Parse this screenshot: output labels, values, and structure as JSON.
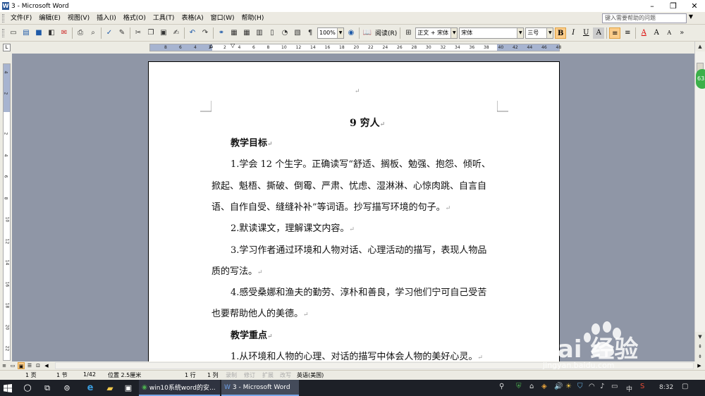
{
  "window": {
    "title": "3 - Microsoft Word",
    "minimize": "–",
    "maximize": "❐",
    "close": "✕"
  },
  "menu": [
    "文件(F)",
    "编辑(E)",
    "视图(V)",
    "插入(I)",
    "格式(O)",
    "工具(T)",
    "表格(A)",
    "窗口(W)",
    "帮助(H)"
  ],
  "help": {
    "placeholder": "键入需要帮助的问题"
  },
  "toolbar": {
    "zoom": "100%",
    "read": "阅读(R)",
    "style": "正文 + 宋体",
    "font": "宋体",
    "size": "三号",
    "bold": "B",
    "italic": "I",
    "underline": "U",
    "char_shade": "A",
    "font_color": "A",
    "grow": "A",
    "shrink": "A"
  },
  "ruler": {
    "h": [
      "8",
      "6",
      "4",
      "2",
      "2",
      "4",
      "6",
      "8",
      "10",
      "12",
      "14",
      "16",
      "18",
      "20",
      "22",
      "24",
      "26",
      "28",
      "30",
      "32",
      "34",
      "36",
      "38",
      "40",
      "42",
      "44",
      "46",
      "48"
    ],
    "v": [
      "4",
      "2",
      "2",
      "4",
      "6",
      "8",
      "10",
      "12",
      "14",
      "16",
      "18",
      "20",
      "22"
    ]
  },
  "document": {
    "page_mark": "↵",
    "title": "9 穷人",
    "paragraphs": [
      {
        "text": "教学目标",
        "bold": true,
        "mark": "↵"
      },
      {
        "text": "1.学会 12 个生字。正确读写“舒适、搁板、勉强、抱怨、倾听、",
        "mark": ""
      },
      {
        "text": "掀起、魁梧、撕破、倒霉、严肃、忧虑、湿淋淋、心惊肉跳、自言自",
        "mark": ""
      },
      {
        "text": "语、自作自受、缝缝补补”等词语。抄写描写环境的句子。",
        "mark": "↵"
      },
      {
        "text": "2.默读课文，理解课文内容。",
        "mark": "↵"
      },
      {
        "text": "3.学习作者通过环境和人物对话、心理活动的描写，表现人物品",
        "mark": ""
      },
      {
        "text": "质的写法。",
        "mark": "↵"
      },
      {
        "text": "4.感受桑娜和渔夫的勤劳、淳朴和善良，学习他们宁可自己受苦",
        "mark": ""
      },
      {
        "text": "也要帮助他人的美德。",
        "mark": "↵"
      },
      {
        "text": "教学重点",
        "bold": true,
        "mark": "↵"
      },
      {
        "text": "1.从环境和人物的心理、对话的描写中体会人物的美好心灵。",
        "mark": "↵"
      }
    ]
  },
  "status": {
    "page": "1 页",
    "section": "1 节",
    "pages": "1/42",
    "position": "位置 2.5厘米",
    "line": "1 行",
    "column": "1 列",
    "rec": "录制",
    "trk": "修订",
    "ext": "扩展",
    "ovr": "改写",
    "lang": "英语(美国)"
  },
  "badge": "63",
  "watermark": {
    "brand": "Bai  经验",
    "url": "jingyan.baidu.com"
  },
  "taskbar": {
    "items": [
      {
        "label": "win10系统word的安..."
      },
      {
        "label": "3 - Microsoft Word"
      }
    ],
    "ime": "中",
    "time": "8:32"
  },
  "colors": {
    "canvas": "#8f96a6",
    "menubar": "#eceae2",
    "taskbar": "#1d2027",
    "highlight": "#fbcd8b"
  }
}
